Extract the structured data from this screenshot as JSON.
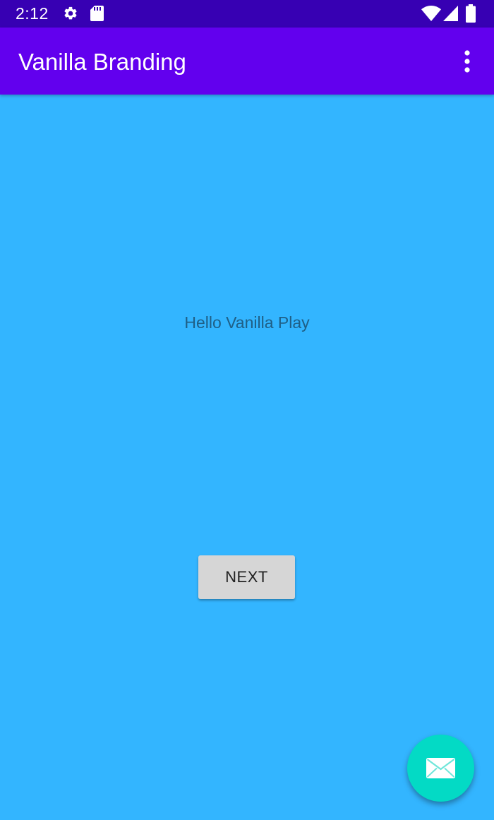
{
  "status_bar": {
    "time": "2:12",
    "icons": [
      "gear-icon",
      "sd-card-icon",
      "wifi-icon",
      "cell-signal-icon",
      "battery-icon"
    ]
  },
  "app_bar": {
    "title": "Vanilla Branding",
    "overflow_icon": "more-vert-icon"
  },
  "main": {
    "hello_text": "Hello Vanilla Play",
    "next_label": "NEXT"
  },
  "fab": {
    "icon": "email-icon"
  },
  "colors": {
    "status_bar": "#3700b3",
    "app_bar": "#6200ee",
    "background": "#33b5ff",
    "fab": "#03dac5",
    "button": "#d6d6d6"
  }
}
